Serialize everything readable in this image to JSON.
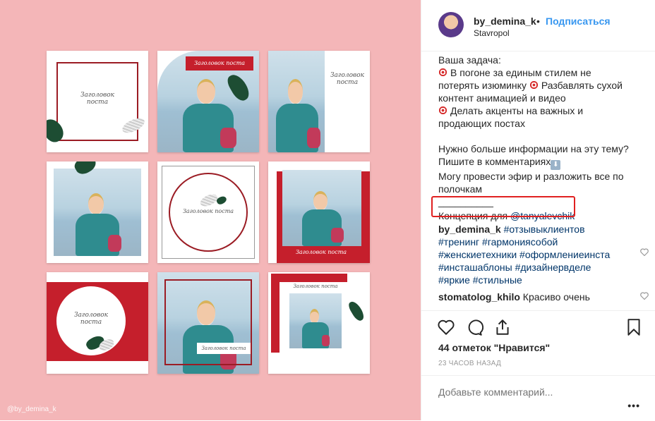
{
  "post": {
    "watermark": "@by_demina_k",
    "tiles": [
      {
        "caption": "Заголовок поста"
      },
      {
        "caption": "Заголовок поста"
      },
      {
        "caption": "Заголовок поста"
      },
      {
        "caption": ""
      },
      {
        "caption": "Заголовок поста"
      },
      {
        "caption": "Заголовок поста"
      },
      {
        "caption": "Заголовок поста"
      },
      {
        "caption": "Заголовок поста"
      },
      {
        "caption": "Заголовок поста"
      }
    ]
  },
  "header": {
    "username": "by_demina_k",
    "separator": "•",
    "follow_label": "Подписаться",
    "location": "Stavropol"
  },
  "caption": {
    "line1": "Ваша задача:",
    "line2": "В погоне за единым стилем не",
    "line3": "потерять изюминку",
    "line3b": "Разбавлять сухой",
    "line4": "контент анимацией и видео",
    "line5": "Делать акценты на важных и",
    "line6": "продающих постах",
    "line7": "Нужно больше информации на эту тему?",
    "line8": "Пишите в комментариях",
    "line9": "Могу провести эфир и разложить все по",
    "line10": "полочкам",
    "divider": "__________",
    "concept_text": "Концепция для",
    "concept_mention": "@tanyalevchik"
  },
  "comments": [
    {
      "user": "by_demina_k",
      "text": "#отзывыклиентов #тренинг #гармониясобой #женскиетехники #оформлениеинста #инсташаблоны #дизайнервделе #яркие #стильные",
      "lines": [
        "#отзывыклиентов",
        "#тренинг #гармониясобой",
        "#женскиетехники #оформлениеинста",
        "#инсташаблоны #дизайнервделе",
        "#яркие #стильные"
      ]
    },
    {
      "user": "stomatolog_khilo",
      "text": "Красиво очень"
    }
  ],
  "actions": {
    "likes": "44 отметок \"Нравится\"",
    "time": "23 ЧАСОВ НАЗАД",
    "add_comment_placeholder": "Добавьте комментарий...",
    "more": "•••"
  }
}
